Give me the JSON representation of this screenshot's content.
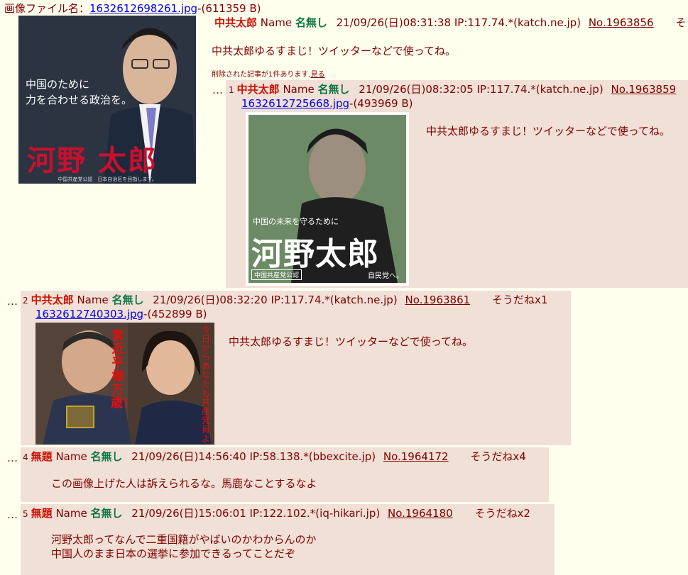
{
  "op": {
    "file_prefix": "画像ファイル名：",
    "file_name": "1632612698261.jpg",
    "file_size": "-(611359 B)",
    "subject": "中共太郎",
    "name_label": "Name",
    "name": "名無し",
    "datetime": "21/09/26(日)08:31:38 IP:117.74.*(katch.ne.jp)",
    "post_no": "No.1963856",
    "trailing": "そ",
    "comment": "中共太郎ゆるすまじ！ツイッターなどで使ってね。",
    "deleted_notice": "削除された記事が1件あります.",
    "deleted_link": "見る",
    "thumb": {
      "caption_line1": "中国のために",
      "caption_line2": "力を合わせる政治を。",
      "big_name": "河野 太郎",
      "footer": "中国共産党公認　日本自治区を目指します。"
    }
  },
  "replies": [
    {
      "dots": "…",
      "index": "1",
      "subject": "中共太郎",
      "name_label": "Name",
      "name": "名無し",
      "datetime": "21/09/26(日)08:32:05 IP:117.74.*(katch.ne.jp)",
      "post_no": "No.1963859",
      "file_name": "1632612725668.jpg",
      "file_size": "-(493969 B)",
      "comment": "中共太郎ゆるすまじ！ツイッターなどで使ってね。",
      "thumb": {
        "caption": "中国の未来を守るために",
        "big_name": "河野太郎",
        "badge": "中国共産党公認",
        "slogan": "自民党へ。"
      }
    },
    {
      "dots": "…",
      "index": "2",
      "subject": "中共太郎",
      "name_label": "Name",
      "name": "名無し",
      "datetime": "21/09/26(日)08:32:20 IP:117.74.*(katch.ne.jp)",
      "post_no": "No.1963861",
      "soudane": "そうだねx1",
      "file_name": "1632612740303.jpg",
      "file_size": "-(452899 B)",
      "comment": "中共太郎ゆるすまじ！ツイッターなどで使ってね。",
      "thumb": {
        "left_vertical": "習近平様万歳！",
        "right_vertical": "今日からあなたも共産党員よ"
      }
    },
    {
      "dots": "…",
      "index": "4",
      "subject": "無題",
      "name_label": "Name",
      "name": "名無し",
      "datetime": "21/09/26(日)14:56:40 IP:58.138.*(bbexcite.jp)",
      "post_no": "No.1964172",
      "soudane": "そうだねx4",
      "comment_lines": [
        "この画像上げた人は訴えられるな。馬鹿なことするなよ"
      ]
    },
    {
      "dots": "…",
      "index": "5",
      "subject": "無題",
      "name_label": "Name",
      "name": "名無し",
      "datetime": "21/09/26(日)15:06:01 IP:122.102.*(iq-hikari.jp)",
      "post_no": "No.1964180",
      "soudane": "そうだねx2",
      "comment_lines": [
        "河野太郎ってなんで二重国籍がやばいのかわからんのか",
        "中国人のまま日本の選挙に参加できるってことだぞ"
      ]
    }
  ]
}
